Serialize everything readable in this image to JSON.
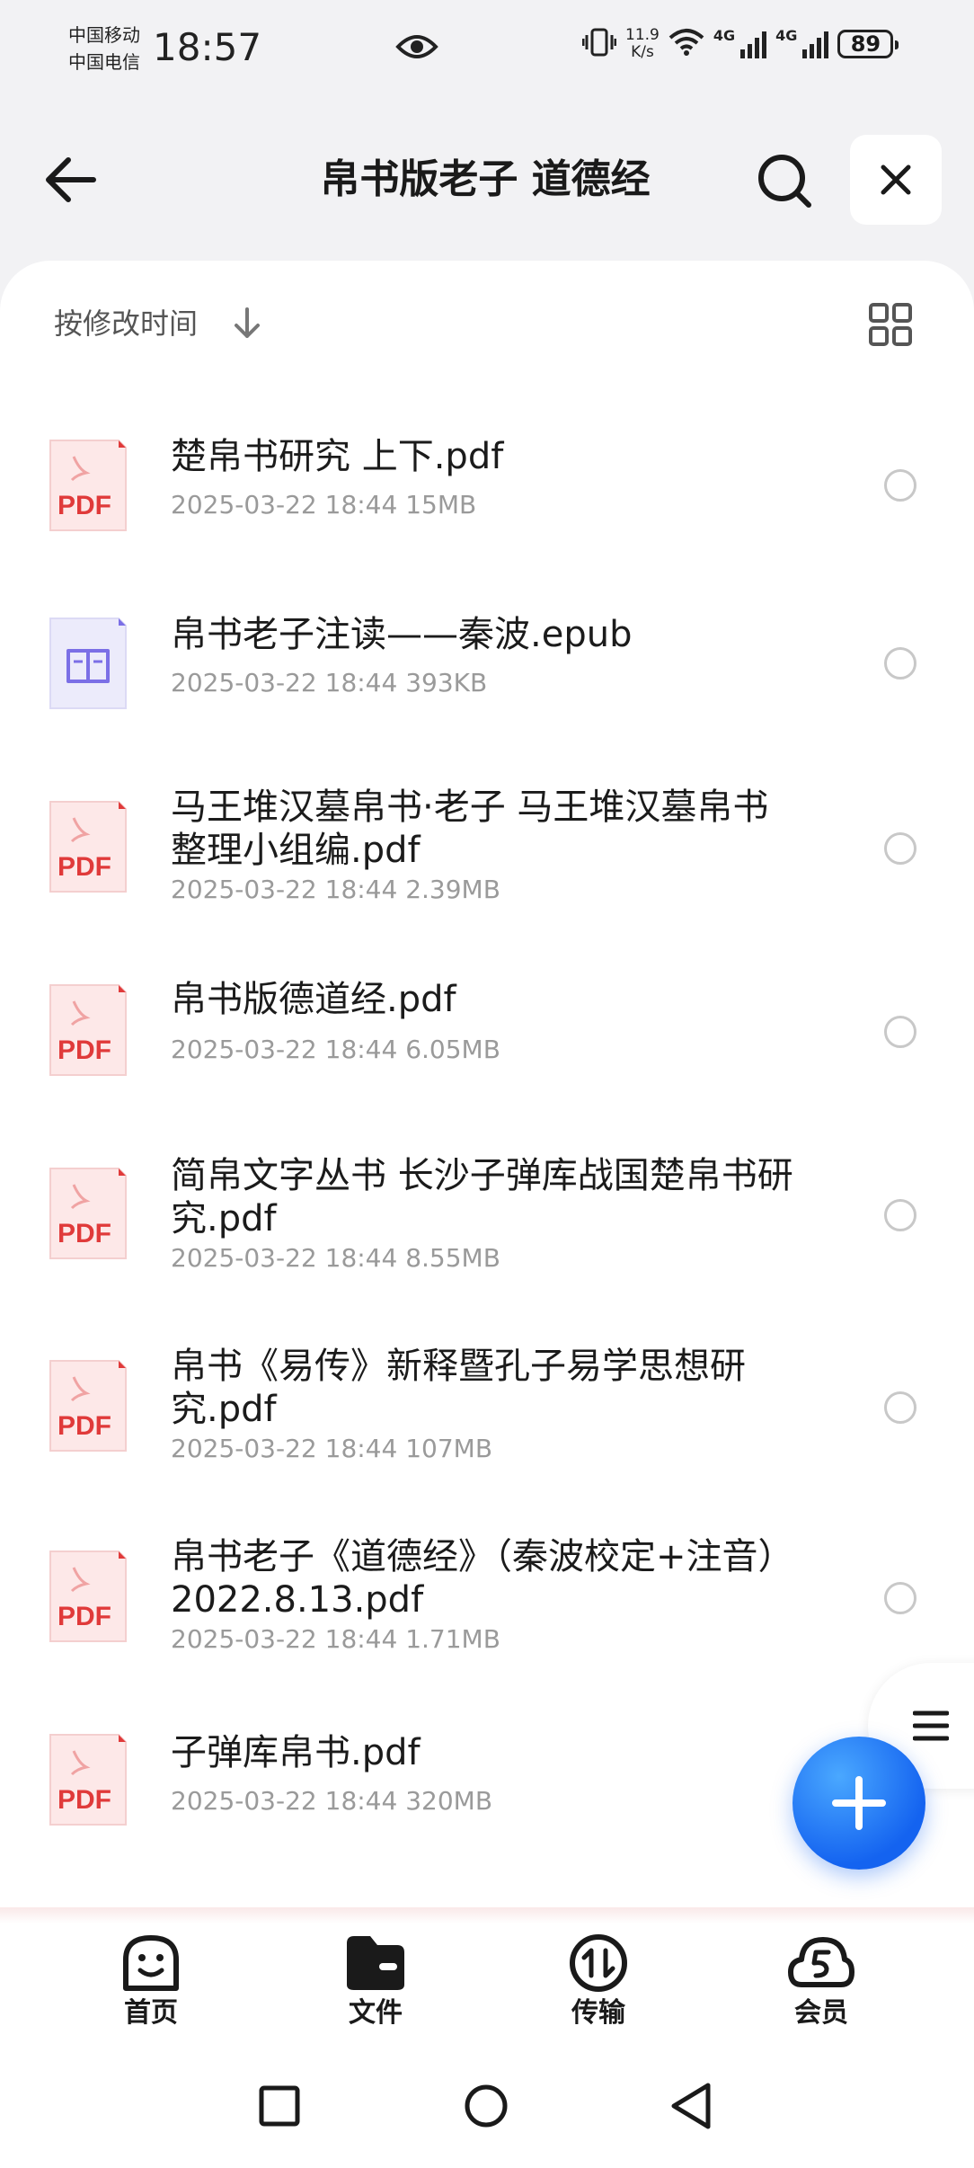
{
  "status_bar": {
    "carrier1": "中国移动",
    "carrier2": "中国电信",
    "time": "18:57",
    "net_speed_value": "11.9",
    "net_speed_unit": "K/s",
    "signal_label1": "4G",
    "signal_label2": "4G",
    "battery": "89"
  },
  "header": {
    "title": "帛书版老子 道德经"
  },
  "toolbar": {
    "sort_label": "按修改时间"
  },
  "files": [
    {
      "name": "楚帛书研究 上下.pdf",
      "meta": "2025-03-22 18:44  15MB",
      "type": "pdf"
    },
    {
      "name": "帛书老子注读——秦波.epub",
      "meta": "2025-03-22 18:44  393KB",
      "type": "epub"
    },
    {
      "name": "马王堆汉墓帛书·老子  马王堆汉墓帛书整理小组编.pdf",
      "meta": "2025-03-22 18:44  2.39MB",
      "type": "pdf"
    },
    {
      "name": "帛书版德道经.pdf",
      "meta": "2025-03-22 18:44  6.05MB",
      "type": "pdf"
    },
    {
      "name": "简帛文字丛书 长沙子弹库战国楚帛书研究.pdf",
      "meta": "2025-03-22 18:44  8.55MB",
      "type": "pdf"
    },
    {
      "name": "帛书《易传》新释暨孔子易学思想研究.pdf",
      "meta": "2025-03-22 18:44  107MB",
      "type": "pdf"
    },
    {
      "name": "帛书老子《道德经》（秦波校定+注音）2022.8.13.pdf",
      "meta": "2025-03-22 18:44  1.71MB",
      "type": "pdf"
    },
    {
      "name": "子弹库帛书.pdf",
      "meta": "2025-03-22 18:44  320MB",
      "type": "pdf"
    }
  ],
  "pdf_icon_text": "PDF",
  "bottom_nav": [
    {
      "label": "首页",
      "icon": "smile-home-icon"
    },
    {
      "label": "文件",
      "icon": "folder-icon"
    },
    {
      "label": "传输",
      "icon": "transfer-icon"
    },
    {
      "label": "会员",
      "icon": "cloud-vip-icon"
    }
  ],
  "colors": {
    "accent": "#1463f0",
    "pdf_red": "#e03a3a",
    "epub_purple": "#7b6fe6"
  }
}
